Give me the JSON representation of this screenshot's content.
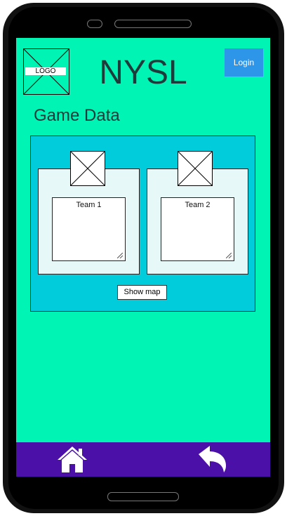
{
  "header": {
    "logo_label": "LOGO",
    "title": "NYSL",
    "login_label": "Login"
  },
  "main": {
    "section_title": "Game Data",
    "teams": [
      {
        "label": "Team 1"
      },
      {
        "label": "Team 2"
      }
    ],
    "show_map_label": "Show map"
  },
  "nav": {
    "items": [
      {
        "icon": "home-icon"
      },
      {
        "icon": "back-arrow-icon"
      }
    ]
  },
  "colors": {
    "screen_bg": "#00f5b5",
    "card_bg": "#00ccdc",
    "team_bg": "#e6f8f8",
    "login_bg": "#2d96e8",
    "nav_bg": "#4a10a8"
  }
}
